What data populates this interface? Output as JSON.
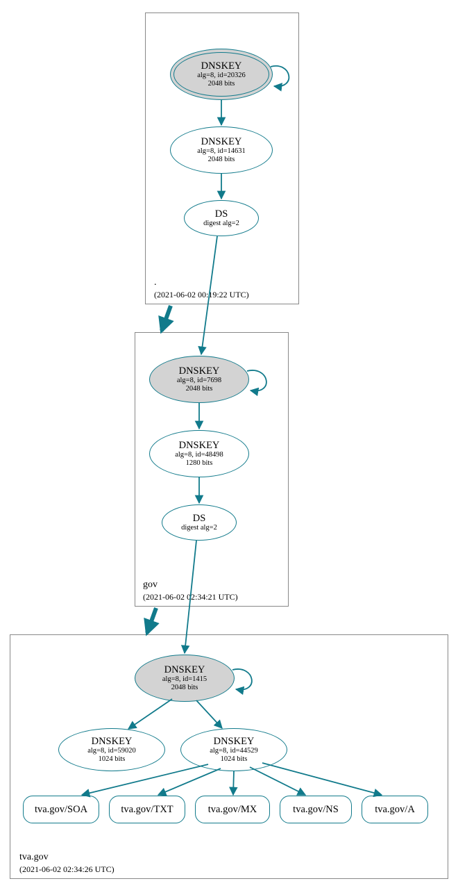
{
  "chart_data": {
    "type": "dnssec-authentication-graph",
    "zones": [
      {
        "name": ".",
        "timestamp": "2021-06-02 00:19:22 UTC",
        "nodes": [
          {
            "id": "root-ksk",
            "type": "DNSKEY",
            "alg": 8,
            "keyid": 20326,
            "bits": 2048,
            "sep": true,
            "self_loop": true
          },
          {
            "id": "root-zsk",
            "type": "DNSKEY",
            "alg": 8,
            "keyid": 14631,
            "bits": 2048
          },
          {
            "id": "root-ds-gov",
            "type": "DS",
            "digest_alg": 2
          }
        ],
        "edges": [
          [
            "root-ksk",
            "root-zsk"
          ],
          [
            "root-zsk",
            "root-ds-gov"
          ]
        ]
      },
      {
        "name": "gov",
        "timestamp": "2021-06-02 02:34:21 UTC",
        "nodes": [
          {
            "id": "gov-ksk",
            "type": "DNSKEY",
            "alg": 8,
            "keyid": 7698,
            "bits": 2048,
            "sep": true,
            "self_loop": true
          },
          {
            "id": "gov-zsk",
            "type": "DNSKEY",
            "alg": 8,
            "keyid": 48498,
            "bits": 1280
          },
          {
            "id": "gov-ds-tva",
            "type": "DS",
            "digest_alg": 2
          }
        ],
        "edges": [
          [
            "gov-ksk",
            "gov-zsk"
          ],
          [
            "gov-zsk",
            "gov-ds-tva"
          ]
        ]
      },
      {
        "name": "tva.gov",
        "timestamp": "2021-06-02 02:34:26 UTC",
        "nodes": [
          {
            "id": "tva-ksk",
            "type": "DNSKEY",
            "alg": 8,
            "keyid": 1415,
            "bits": 2048,
            "sep": true,
            "self_loop": true
          },
          {
            "id": "tva-zsk-a",
            "type": "DNSKEY",
            "alg": 8,
            "keyid": 59020,
            "bits": 1024
          },
          {
            "id": "tva-zsk-b",
            "type": "DNSKEY",
            "alg": 8,
            "keyid": 44529,
            "bits": 1024
          },
          {
            "id": "rr-soa",
            "type": "RRset",
            "label": "tva.gov/SOA"
          },
          {
            "id": "rr-txt",
            "type": "RRset",
            "label": "tva.gov/TXT"
          },
          {
            "id": "rr-mx",
            "type": "RRset",
            "label": "tva.gov/MX"
          },
          {
            "id": "rr-ns",
            "type": "RRset",
            "label": "tva.gov/NS"
          },
          {
            "id": "rr-a",
            "type": "RRset",
            "label": "tva.gov/A"
          }
        ],
        "edges": [
          [
            "tva-ksk",
            "tva-zsk-a"
          ],
          [
            "tva-ksk",
            "tva-zsk-b"
          ],
          [
            "tva-zsk-b",
            "rr-soa"
          ],
          [
            "tva-zsk-b",
            "rr-txt"
          ],
          [
            "tva-zsk-b",
            "rr-mx"
          ],
          [
            "tva-zsk-b",
            "rr-ns"
          ],
          [
            "tva-zsk-b",
            "rr-a"
          ]
        ],
        "delegation_edges": [
          [
            "root-ds-gov",
            "gov-ksk"
          ],
          [
            "gov-ds-tva",
            "tva-ksk"
          ]
        ]
      }
    ]
  },
  "zones": {
    "root": {
      "name": ".",
      "timestamp": "(2021-06-02 00:19:22 UTC)"
    },
    "gov": {
      "name": "gov",
      "timestamp": "(2021-06-02 02:34:21 UTC)"
    },
    "tva": {
      "name": "tva.gov",
      "timestamp": "(2021-06-02 02:34:26 UTC)"
    }
  },
  "nodes": {
    "root_ksk": {
      "title": "DNSKEY",
      "line2": "alg=8, id=20326",
      "line3": "2048 bits"
    },
    "root_zsk": {
      "title": "DNSKEY",
      "line2": "alg=8, id=14631",
      "line3": "2048 bits"
    },
    "root_ds": {
      "title": "DS",
      "line2": "digest alg=2"
    },
    "gov_ksk": {
      "title": "DNSKEY",
      "line2": "alg=8, id=7698",
      "line3": "2048 bits"
    },
    "gov_zsk": {
      "title": "DNSKEY",
      "line2": "alg=8, id=48498",
      "line3": "1280 bits"
    },
    "gov_ds": {
      "title": "DS",
      "line2": "digest alg=2"
    },
    "tva_ksk": {
      "title": "DNSKEY",
      "line2": "alg=8, id=1415",
      "line3": "2048 bits"
    },
    "tva_zsk_a": {
      "title": "DNSKEY",
      "line2": "alg=8, id=59020",
      "line3": "1024 bits"
    },
    "tva_zsk_b": {
      "title": "DNSKEY",
      "line2": "alg=8, id=44529",
      "line3": "1024 bits"
    },
    "rr_soa": {
      "label": "tva.gov/SOA"
    },
    "rr_txt": {
      "label": "tva.gov/TXT"
    },
    "rr_mx": {
      "label": "tva.gov/MX"
    },
    "rr_ns": {
      "label": "tva.gov/NS"
    },
    "rr_a": {
      "label": "tva.gov/A"
    }
  }
}
